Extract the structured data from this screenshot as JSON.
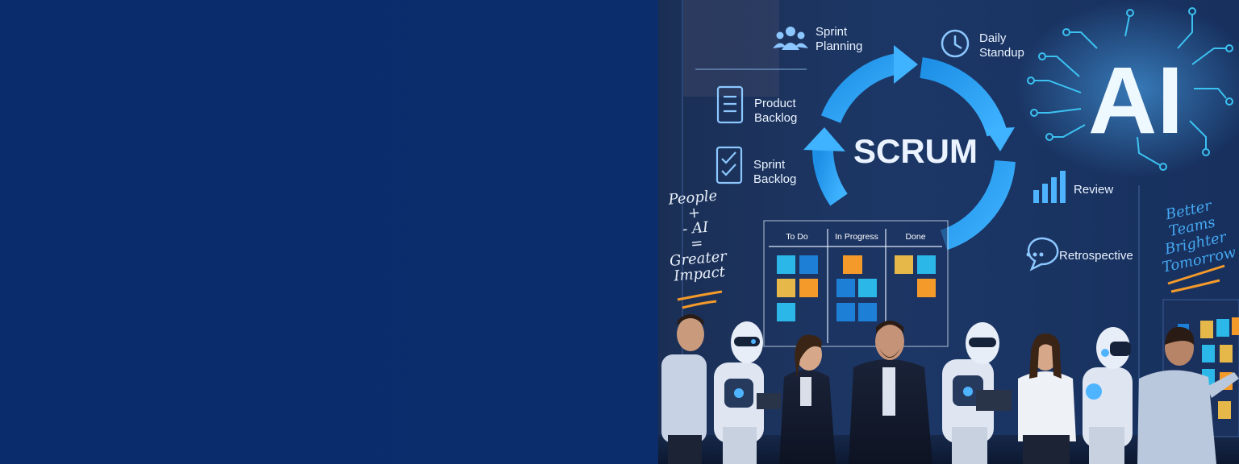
{
  "scene": {
    "center_word": "SCRUM",
    "ai_word": "AI",
    "labels": {
      "sprint_planning": "Sprint\nPlanning",
      "daily_standup": "Daily\nStandup",
      "product_backlog": "Product\nBacklog",
      "sprint_backlog": "Sprint\nBacklog",
      "review": "Review",
      "retrospective": "Retrospective"
    },
    "handwriting_left": "People\n+\n- AI\n=\nGreater\nImpact",
    "handwriting_right": "Better\nTeams\nBrighter\nTomorrow",
    "kanban_columns": [
      "To Do",
      "In Progress",
      "Done"
    ]
  },
  "colors": {
    "banner_blue": "#0b2d6b",
    "accent_cyan": "#3fa9f5",
    "note_orange": "#f39a2b",
    "note_yellow": "#e6b84a",
    "note_cyan": "#2bb7e8",
    "note_blue": "#1e7fd6"
  },
  "icons": [
    "people-icon",
    "clock-icon",
    "document-icon",
    "checklist-icon",
    "bar-chart-icon",
    "chat-bubble-icon",
    "circuit-icon"
  ]
}
